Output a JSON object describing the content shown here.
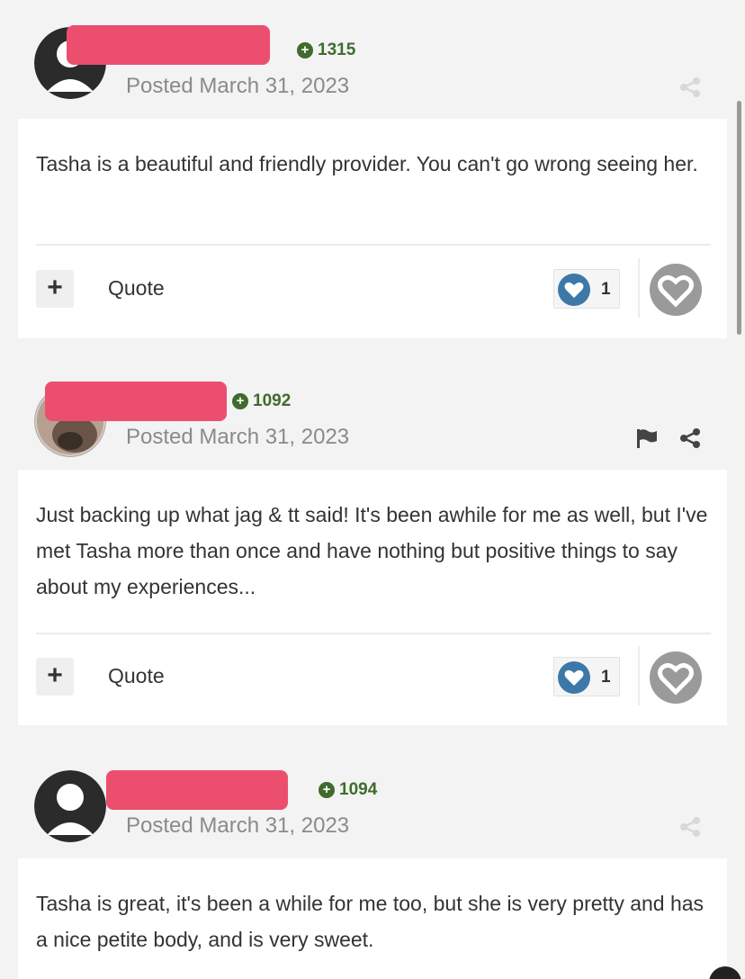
{
  "posts": [
    {
      "reputation": "1315",
      "posted": "Posted March 31, 2023",
      "body": "Tasha is a beautiful and friendly provider.  You can't go wrong seeing her.",
      "quote_label": "Quote",
      "reaction_count": "1",
      "avatar": "default-avatar"
    },
    {
      "reputation": "1092",
      "posted": "Posted March 31, 2023",
      "body": "Just backing up what jag & tt said! It's been awhile for me as well, but I've met Tasha more than once and have nothing but positive things to say about my experiences...",
      "quote_label": "Quote",
      "reaction_count": "1",
      "avatar": "photo-avatar"
    },
    {
      "reputation": "1094",
      "posted": "Posted March 31, 2023",
      "body": "Tasha is great, it's been a while for me too, but she is very pretty and has a nice petite body, and is very sweet.",
      "avatar": "default-avatar"
    }
  ],
  "colors": {
    "redaction": "#ec4f6e",
    "reputation": "#3f6b2e",
    "reaction_heart": "#3d78a8",
    "like_button": "#9a9a9a"
  },
  "icons": [
    "flag-icon",
    "share-icon",
    "heart-icon",
    "plus-icon"
  ]
}
